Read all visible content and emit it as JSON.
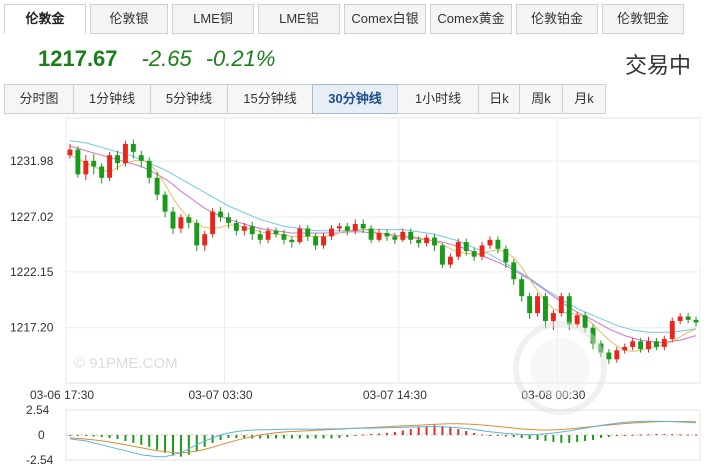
{
  "tabs": [
    "伦敦金",
    "伦敦银",
    "LME铜",
    "LME铝",
    "Comex白银",
    "Comex黄金",
    "伦敦铂金",
    "伦敦钯金"
  ],
  "active_tab": 0,
  "quote": {
    "price": "1217.67",
    "change": "-2.65",
    "change_pct": "-0.21%",
    "status": "交易中"
  },
  "periods": [
    "分时图",
    "1分钟线",
    "5分钟线",
    "15分钟线",
    "30分钟线",
    "1小时线",
    "日k",
    "周k",
    "月k"
  ],
  "active_period": 4,
  "colors": {
    "up": "#e8261b",
    "down": "#1a9a1a",
    "ma_short": "#e0c060",
    "ma_mid": "#d070d0",
    "ma_long": "#70c8e8",
    "quote": "#1a7f1a"
  },
  "watermark": "© 91PME.COM",
  "chart_data": [
    {
      "type": "candlestick",
      "y_ticks": [
        "1231.98",
        "1227.02",
        "1222.15",
        "1217.20"
      ],
      "ylim": [
        1212.3,
        1235.8
      ],
      "x_ticks": [
        {
          "label": "03-06 17:30",
          "index": 0
        },
        {
          "label": "03-07 03:30",
          "index": 20
        },
        {
          "label": "03-07 14:30",
          "index": 42
        },
        {
          "label": "03-08 00:30",
          "index": 62
        }
      ],
      "ohlc": [
        [
          1232.5,
          1233.0,
          1233.5,
          1232.2
        ],
        [
          1233.0,
          1230.8,
          1233.3,
          1230.5
        ],
        [
          1230.8,
          1232.0,
          1232.5,
          1230.3
        ],
        [
          1232.0,
          1231.5,
          1232.6,
          1230.8
        ],
        [
          1231.5,
          1230.5,
          1231.8,
          1230.0
        ],
        [
          1230.5,
          1232.5,
          1232.8,
          1230.2
        ],
        [
          1232.5,
          1231.8,
          1232.9,
          1231.2
        ],
        [
          1231.8,
          1233.5,
          1233.8,
          1231.5
        ],
        [
          1233.5,
          1232.8,
          1233.9,
          1232.2
        ],
        [
          1232.5,
          1232.0,
          1232.9,
          1231.4
        ],
        [
          1232.0,
          1230.5,
          1232.3,
          1230.0
        ],
        [
          1230.5,
          1229.0,
          1231.0,
          1228.5
        ],
        [
          1229.0,
          1227.5,
          1229.3,
          1227.0
        ],
        [
          1227.5,
          1226.0,
          1227.9,
          1225.5
        ],
        [
          1226.0,
          1227.0,
          1227.3,
          1225.6
        ],
        [
          1227.0,
          1226.5,
          1227.3,
          1226.0
        ],
        [
          1226.5,
          1224.5,
          1226.8,
          1224.0
        ],
        [
          1224.5,
          1225.5,
          1225.8,
          1224.0
        ],
        [
          1225.5,
          1227.5,
          1227.8,
          1225.2
        ],
        [
          1227.5,
          1227.0,
          1227.9,
          1226.6
        ],
        [
          1227.0,
          1226.5,
          1227.4,
          1226.0
        ],
        [
          1226.5,
          1225.8,
          1226.8,
          1225.4
        ],
        [
          1225.8,
          1226.2,
          1226.5,
          1225.4
        ],
        [
          1226.2,
          1225.5,
          1226.6,
          1225.0
        ],
        [
          1225.5,
          1225.0,
          1225.9,
          1224.6
        ],
        [
          1225.0,
          1225.8,
          1226.1,
          1224.7
        ],
        [
          1225.8,
          1225.5,
          1226.1,
          1225.2
        ],
        [
          1225.5,
          1225.0,
          1225.9,
          1224.6
        ],
        [
          1225.0,
          1224.8,
          1225.3,
          1224.3
        ],
        [
          1224.8,
          1226.0,
          1226.3,
          1224.6
        ],
        [
          1226.0,
          1225.3,
          1226.3,
          1224.9
        ],
        [
          1225.3,
          1224.5,
          1225.6,
          1224.1
        ],
        [
          1224.5,
          1225.3,
          1225.6,
          1224.2
        ],
        [
          1225.3,
          1226.0,
          1226.3,
          1225.0
        ],
        [
          1226.0,
          1226.2,
          1226.5,
          1225.7
        ],
        [
          1226.2,
          1225.8,
          1226.5,
          1225.4
        ],
        [
          1225.8,
          1226.4,
          1226.8,
          1225.5
        ],
        [
          1226.4,
          1226.0,
          1226.8,
          1225.6
        ],
        [
          1226.0,
          1225.0,
          1226.3,
          1224.7
        ],
        [
          1225.0,
          1225.6,
          1226.0,
          1224.8
        ],
        [
          1225.6,
          1225.3,
          1225.9,
          1224.9
        ],
        [
          1225.3,
          1225.0,
          1225.6,
          1224.6
        ],
        [
          1225.0,
          1225.7,
          1226.0,
          1224.8
        ],
        [
          1225.7,
          1225.0,
          1226.0,
          1224.6
        ],
        [
          1225.0,
          1224.7,
          1225.3,
          1224.3
        ],
        [
          1224.7,
          1225.2,
          1225.5,
          1224.4
        ],
        [
          1225.2,
          1224.5,
          1225.5,
          1224.0
        ],
        [
          1224.5,
          1222.8,
          1224.7,
          1222.5
        ],
        [
          1222.8,
          1223.5,
          1223.8,
          1222.5
        ],
        [
          1223.5,
          1224.8,
          1225.1,
          1223.2
        ],
        [
          1224.8,
          1224.0,
          1225.1,
          1223.6
        ],
        [
          1224.0,
          1223.5,
          1224.3,
          1223.1
        ],
        [
          1223.5,
          1224.5,
          1224.8,
          1223.2
        ],
        [
          1224.5,
          1225.0,
          1225.3,
          1224.2
        ],
        [
          1225.0,
          1224.2,
          1225.3,
          1223.8
        ],
        [
          1224.2,
          1223.0,
          1224.5,
          1222.5
        ],
        [
          1223.0,
          1221.5,
          1223.3,
          1221.0
        ],
        [
          1221.5,
          1220.0,
          1221.8,
          1219.5
        ],
        [
          1220.0,
          1218.5,
          1220.3,
          1218.0
        ],
        [
          1218.5,
          1220.0,
          1220.3,
          1218.2
        ],
        [
          1220.0,
          1217.8,
          1220.3,
          1217.2
        ],
        [
          1217.8,
          1218.5,
          1218.8,
          1217.0
        ],
        [
          1218.5,
          1220.0,
          1220.3,
          1218.2
        ],
        [
          1220.0,
          1217.5,
          1220.3,
          1217.0
        ],
        [
          1217.5,
          1218.3,
          1218.6,
          1217.2
        ],
        [
          1218.3,
          1217.2,
          1218.6,
          1216.8
        ],
        [
          1217.2,
          1215.8,
          1217.5,
          1215.3
        ],
        [
          1215.8,
          1215.0,
          1216.1,
          1214.6
        ],
        [
          1215.0,
          1214.4,
          1215.3,
          1214.0
        ],
        [
          1214.4,
          1215.2,
          1215.5,
          1214.1
        ],
        [
          1215.2,
          1215.5,
          1215.8,
          1214.9
        ],
        [
          1215.5,
          1216.0,
          1216.3,
          1215.2
        ],
        [
          1216.0,
          1215.3,
          1216.3,
          1215.0
        ],
        [
          1215.3,
          1216.0,
          1216.4,
          1215.0
        ],
        [
          1216.0,
          1215.5,
          1216.3,
          1215.2
        ],
        [
          1215.5,
          1216.2,
          1216.5,
          1215.2
        ],
        [
          1216.2,
          1217.8,
          1218.1,
          1215.9
        ],
        [
          1217.8,
          1218.2,
          1218.5,
          1217.5
        ],
        [
          1218.2,
          1217.9,
          1218.5,
          1217.6
        ],
        [
          1217.9,
          1217.67,
          1218.2,
          1217.3
        ]
      ],
      "ma_short": [
        1232.5,
        1232.2,
        1231.8,
        1231.5,
        1231.2,
        1231.0,
        1231.4,
        1231.8,
        1232.0,
        1232.1,
        1231.8,
        1231.0,
        1229.9,
        1228.7,
        1227.7,
        1226.9,
        1226.4,
        1226.1,
        1226.0,
        1226.1,
        1226.3,
        1226.3,
        1226.1,
        1225.9,
        1225.7,
        1225.6,
        1225.5,
        1225.4,
        1225.3,
        1225.3,
        1225.3,
        1225.3,
        1225.3,
        1225.4,
        1225.6,
        1225.8,
        1225.9,
        1225.9,
        1225.8,
        1225.6,
        1225.5,
        1225.3,
        1225.3,
        1225.3,
        1225.2,
        1225.0,
        1224.9,
        1224.6,
        1224.2,
        1223.9,
        1223.8,
        1223.7,
        1223.8,
        1224.0,
        1224.1,
        1223.9,
        1223.4,
        1222.6,
        1221.5,
        1220.5,
        1219.5,
        1218.9,
        1218.6,
        1218.5,
        1218.4,
        1218.1,
        1217.5,
        1216.8,
        1216.1,
        1215.6,
        1215.2,
        1215.1,
        1215.2,
        1215.4,
        1215.5,
        1215.7,
        1216.0,
        1216.4,
        1216.8,
        1217.1
      ],
      "ma_mid": [
        1233.3,
        1233.1,
        1232.9,
        1232.7,
        1232.5,
        1232.3,
        1232.1,
        1231.9,
        1231.7,
        1231.5,
        1231.2,
        1230.8,
        1230.4,
        1229.9,
        1229.3,
        1228.8,
        1228.3,
        1227.8,
        1227.4,
        1227.1,
        1226.8,
        1226.6,
        1226.4,
        1226.2,
        1226.0,
        1225.9,
        1225.8,
        1225.7,
        1225.6,
        1225.6,
        1225.6,
        1225.6,
        1225.6,
        1225.6,
        1225.6,
        1225.7,
        1225.7,
        1225.7,
        1225.6,
        1225.6,
        1225.5,
        1225.4,
        1225.3,
        1225.2,
        1225.1,
        1225.0,
        1224.9,
        1224.8,
        1224.6,
        1224.4,
        1224.2,
        1223.9,
        1223.6,
        1223.3,
        1223.0,
        1222.7,
        1222.3,
        1221.9,
        1221.5,
        1221.0,
        1220.5,
        1220.0,
        1219.5,
        1219.0,
        1218.6,
        1218.2,
        1217.9,
        1217.5,
        1217.1,
        1216.8,
        1216.5,
        1216.3,
        1216.1,
        1216.0,
        1215.9,
        1215.9,
        1216.0,
        1216.1,
        1216.3,
        1216.5
      ],
      "ma_long": [
        1233.8,
        1233.7,
        1233.6,
        1233.4,
        1233.2,
        1233.0,
        1232.8,
        1232.6,
        1232.4,
        1232.1,
        1231.8,
        1231.5,
        1231.2,
        1230.8,
        1230.4,
        1230.0,
        1229.6,
        1229.2,
        1228.8,
        1228.4,
        1228.0,
        1227.7,
        1227.4,
        1227.1,
        1226.8,
        1226.6,
        1226.4,
        1226.2,
        1226.1,
        1226.0,
        1225.9,
        1225.8,
        1225.8,
        1225.8,
        1225.8,
        1225.8,
        1225.8,
        1225.9,
        1225.9,
        1225.9,
        1225.9,
        1225.9,
        1225.9,
        1225.8,
        1225.7,
        1225.6,
        1225.5,
        1225.3,
        1225.1,
        1224.9,
        1224.6,
        1224.3,
        1224.0,
        1223.7,
        1223.3,
        1222.9,
        1222.5,
        1222.0,
        1221.6,
        1221.1,
        1220.6,
        1220.2,
        1219.7,
        1219.3,
        1218.9,
        1218.6,
        1218.3,
        1218.0,
        1217.7,
        1217.4,
        1217.2,
        1217.0,
        1216.9,
        1216.8,
        1216.8,
        1216.8,
        1216.8,
        1216.9,
        1217.0,
        1217.1
      ]
    },
    {
      "type": "macd",
      "y_ticks": [
        "2.54",
        "0",
        "-2.54"
      ],
      "ylim": [
        -2.54,
        2.54
      ],
      "hist": [
        -0.05,
        -0.08,
        -0.1,
        -0.15,
        -0.2,
        -0.3,
        -0.4,
        -0.6,
        -0.8,
        -1.0,
        -1.2,
        -1.5,
        -1.8,
        -2.1,
        -2.2,
        -2.0,
        -1.6,
        -1.2,
        -0.8,
        -0.5,
        -0.3,
        -0.3,
        -0.35,
        -0.35,
        -0.35,
        -0.35,
        -0.35,
        -0.35,
        -0.35,
        -0.35,
        -0.35,
        -0.35,
        -0.35,
        -0.35,
        -0.3,
        -0.2,
        -0.1,
        0.05,
        0.1,
        0.15,
        0.2,
        0.3,
        0.45,
        0.6,
        0.8,
        0.9,
        1.0,
        0.9,
        0.8,
        0.6,
        0.4,
        0.2,
        0.05,
        -0.05,
        -0.1,
        -0.15,
        -0.2,
        -0.3,
        -0.4,
        -0.5,
        -0.6,
        -0.7,
        -0.8,
        -0.8,
        -0.7,
        -0.6,
        -0.5,
        -0.3,
        -0.2,
        -0.1,
        -0.05,
        0.02,
        0.05,
        0.08,
        0.1,
        0.1,
        0.08,
        0.06,
        0.05,
        0.05
      ],
      "dif": [
        -0.4,
        -0.5,
        -0.6,
        -0.8,
        -1.0,
        -1.2,
        -1.4,
        -1.6,
        -1.8,
        -2.0,
        -2.1,
        -2.2,
        -2.2,
        -2.0,
        -1.8,
        -1.4,
        -1.0,
        -0.6,
        -0.3,
        0.0,
        0.2,
        0.35,
        0.45,
        0.5,
        0.52,
        0.54,
        0.56,
        0.58,
        0.6,
        0.6,
        0.6,
        0.6,
        0.6,
        0.62,
        0.64,
        0.66,
        0.68,
        0.7,
        0.7,
        0.72,
        0.74,
        0.76,
        0.78,
        0.8,
        0.82,
        0.84,
        0.86,
        0.84,
        0.8,
        0.74,
        0.66,
        0.56,
        0.44,
        0.34,
        0.24,
        0.16,
        0.1,
        0.06,
        0.04,
        0.06,
        0.12,
        0.2,
        0.3,
        0.42,
        0.56,
        0.7,
        0.84,
        0.98,
        1.1,
        1.2,
        1.28,
        1.34,
        1.38,
        1.4,
        1.4,
        1.38,
        1.36,
        1.32,
        1.28,
        1.24
      ],
      "dea": [
        -0.3,
        -0.35,
        -0.42,
        -0.5,
        -0.6,
        -0.72,
        -0.85,
        -1.0,
        -1.15,
        -1.3,
        -1.45,
        -1.58,
        -1.7,
        -1.78,
        -1.8,
        -1.76,
        -1.64,
        -1.46,
        -1.24,
        -1.0,
        -0.76,
        -0.54,
        -0.34,
        -0.16,
        0.0,
        0.12,
        0.22,
        0.3,
        0.36,
        0.4,
        0.44,
        0.48,
        0.52,
        0.56,
        0.6,
        0.64,
        0.68,
        0.72,
        0.76,
        0.8,
        0.84,
        0.88,
        0.92,
        0.96,
        1.0,
        1.04,
        1.08,
        1.12,
        1.14,
        1.14,
        1.12,
        1.08,
        1.02,
        0.94,
        0.86,
        0.78,
        0.7,
        0.62,
        0.56,
        0.52,
        0.5,
        0.52,
        0.56,
        0.62,
        0.7,
        0.78,
        0.86,
        0.94,
        1.02,
        1.1,
        1.16,
        1.22,
        1.27,
        1.31,
        1.34,
        1.36,
        1.37,
        1.37,
        1.36,
        1.34
      ]
    }
  ]
}
